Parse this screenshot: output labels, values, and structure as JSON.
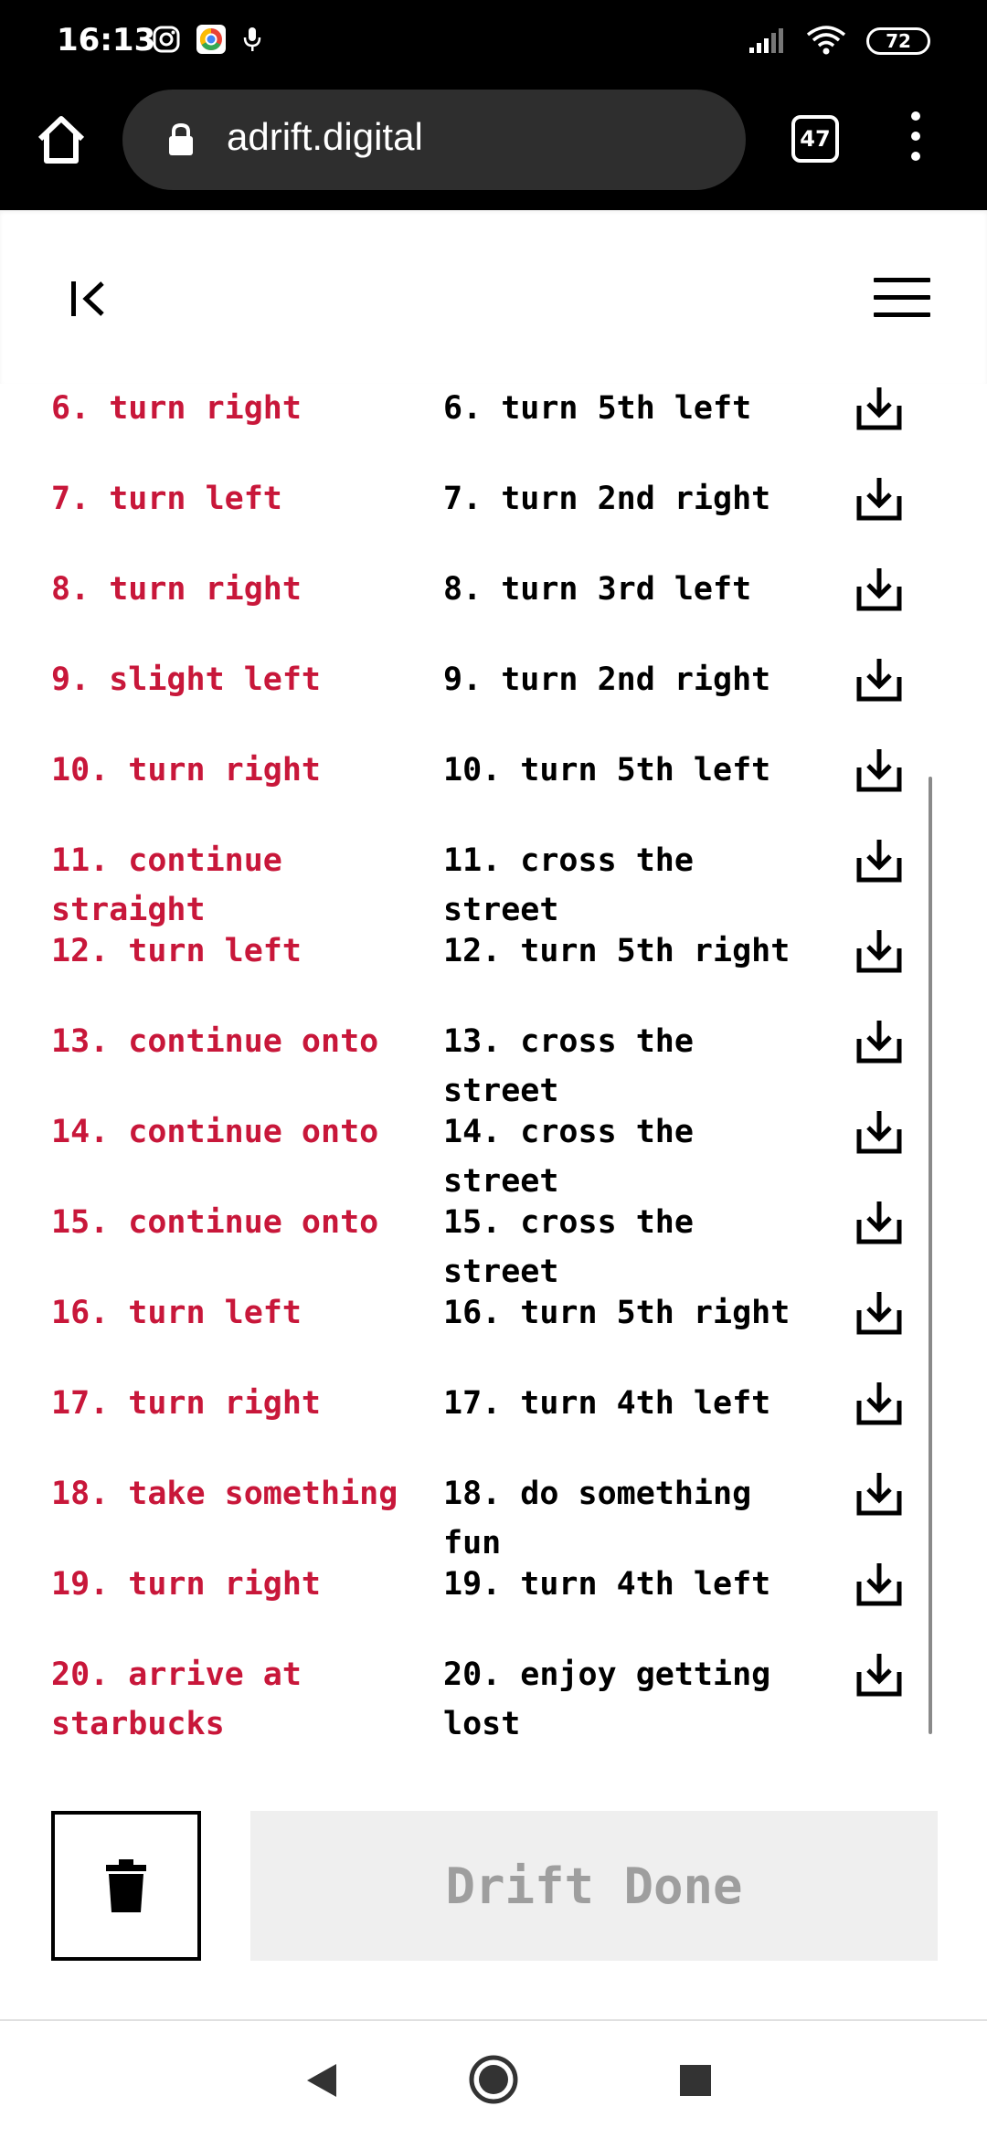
{
  "status_bar": {
    "time": "16:13",
    "battery": "72"
  },
  "browser": {
    "url": "adrift.digital",
    "tab_count": "47"
  },
  "rows": [
    {
      "left": "6. turn right",
      "right": "6. turn 5th left"
    },
    {
      "left": "7. turn left",
      "right": "7. turn 2nd right"
    },
    {
      "left": "8. turn right",
      "right": "8. turn 3rd left"
    },
    {
      "left": "9. slight left",
      "right": "9. turn 2nd right"
    },
    {
      "left": "10. turn right",
      "right": "10. turn 5th left"
    },
    {
      "left": "11. continue straight",
      "right": "11. cross the street"
    },
    {
      "left": "12. turn left",
      "right": "12. turn 5th right"
    },
    {
      "left": "13. continue onto",
      "right": "13. cross the street"
    },
    {
      "left": "14. continue onto",
      "right": "14. cross the street"
    },
    {
      "left": "15. continue onto",
      "right": "15. cross the street"
    },
    {
      "left": "16. turn left",
      "right": "16. turn 5th right"
    },
    {
      "left": "17. turn right",
      "right": "17. turn 4th left"
    },
    {
      "left": "18. take something",
      "right": "18. do something fun"
    },
    {
      "left": "19. turn right",
      "right": "19. turn 4th left"
    },
    {
      "left": "20. arrive at starbucks",
      "right": "20. enjoy getting lost"
    }
  ],
  "actions": {
    "done_label": "Drift Done"
  },
  "colors": {
    "accent_red": "#c8173a",
    "done_bg": "#efefef",
    "done_text": "#9e9e9e"
  }
}
